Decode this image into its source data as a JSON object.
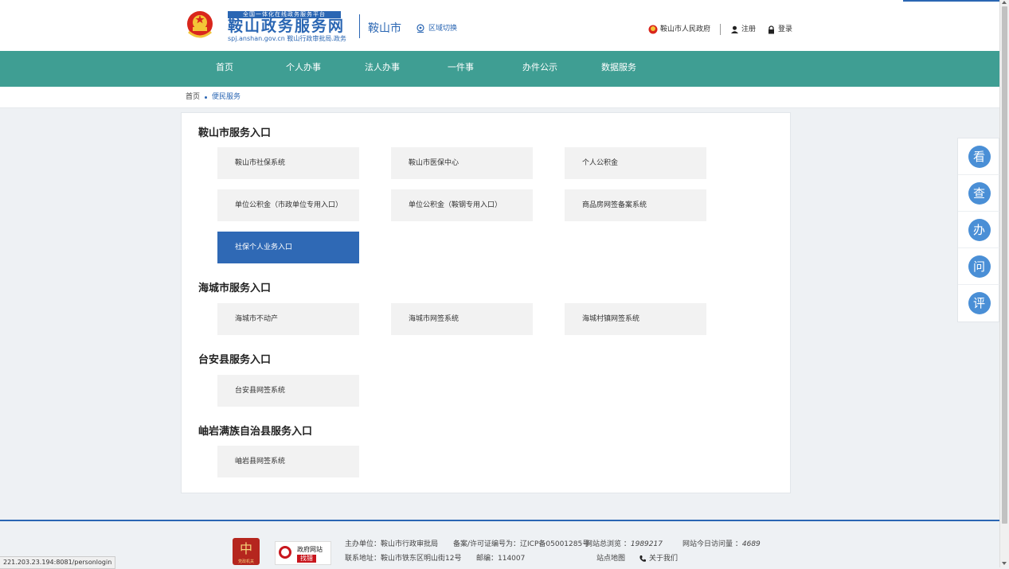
{
  "header": {
    "logo_tag": "全国一体化在线政务服务平台",
    "logo_title": "鞍山政务服务网",
    "logo_url": "spj.anshan.gov.cn 鞍山行政审批局.政务",
    "city": "鞍山市",
    "region_switch": "区域切换",
    "gov_link": "鞍山市人民政府",
    "register": "注册",
    "login": "登录"
  },
  "nav": {
    "items": [
      {
        "label": "首页"
      },
      {
        "label": "个人办事"
      },
      {
        "label": "法人办事"
      },
      {
        "label": "一件事"
      },
      {
        "label": "办件公示"
      },
      {
        "label": "数据服务"
      }
    ]
  },
  "breadcrumb": {
    "home": "首页",
    "current": "便民服务"
  },
  "sections": [
    {
      "title": "鞍山市服务入口",
      "items": [
        {
          "label": "鞍山市社保系统"
        },
        {
          "label": "鞍山市医保中心"
        },
        {
          "label": "个人公积金"
        },
        {
          "label": "单位公积金（市政单位专用入口）"
        },
        {
          "label": "单位公积金（鞍钢专用入口）"
        },
        {
          "label": "商品房网签备案系统"
        },
        {
          "label": "社保个人业务入口",
          "active": true
        }
      ]
    },
    {
      "title": "海城市服务入口",
      "items": [
        {
          "label": "海城市不动产"
        },
        {
          "label": "海城市网签系统"
        },
        {
          "label": "海城村镇网签系统"
        }
      ]
    },
    {
      "title": "台安县服务入口",
      "items": [
        {
          "label": "台安县网签系统"
        }
      ]
    },
    {
      "title": "岫岩满族自治县服务入口",
      "items": [
        {
          "label": "岫岩县网签系统"
        }
      ]
    }
  ],
  "side_float": {
    "items": [
      {
        "label": "看"
      },
      {
        "label": "查"
      },
      {
        "label": "办"
      },
      {
        "label": "问"
      },
      {
        "label": "评"
      }
    ]
  },
  "footer": {
    "badge1_char": "中",
    "badge1_sub": "党政机关",
    "badge2_line1": "政府网站",
    "badge2_line2": "找错",
    "sponsor": "主办单位：鞍山市行政审批局",
    "icp": "备案/许可证编号为：辽ICP备05001285号",
    "total_visits_label": "网站总浏览 ：",
    "total_visits": "1989217",
    "today_visits_label": "网站今日访问量 ：",
    "today_visits": "4689",
    "address": "联系地址：鞍山市铁东区明山街12号",
    "postcode": "邮编：114007",
    "sitemap": "站点地图",
    "about": "关于我们"
  },
  "status_bar": {
    "url": "221.203.23.194:8081/personlogin"
  },
  "colors": {
    "brand_blue": "#2a66b3",
    "nav_teal": "#3f9e93",
    "active_button": "#2f69b5",
    "float_circle": "#4a8fd6"
  }
}
